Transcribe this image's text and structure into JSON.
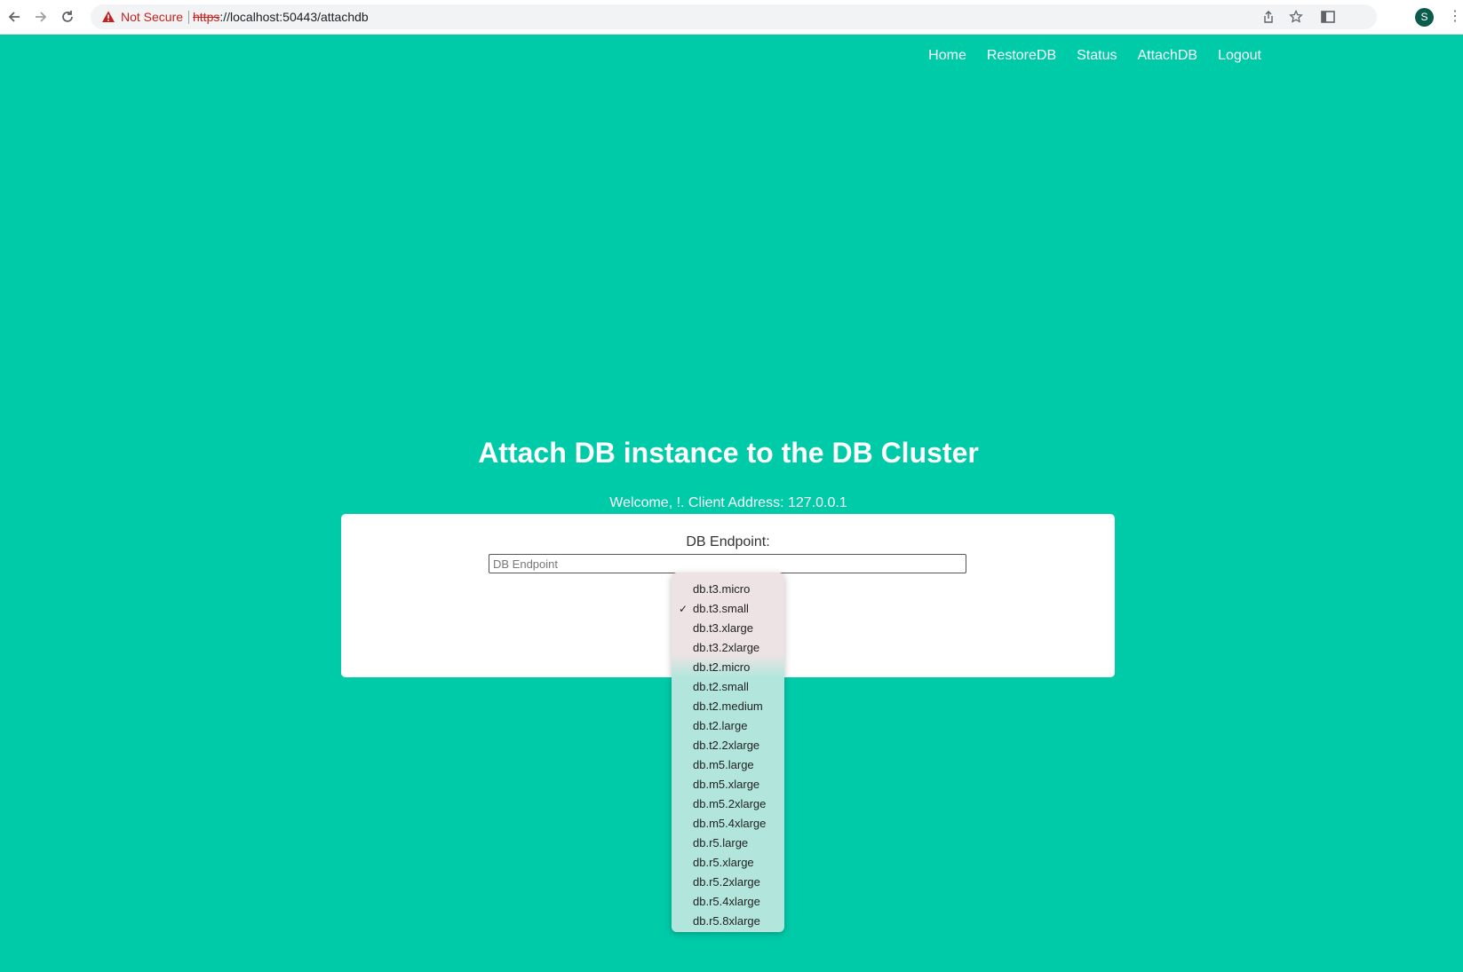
{
  "browser": {
    "security_label": "Not Secure",
    "url_scheme": "https",
    "url_rest": "://localhost:50443/attachdb",
    "profile_initial": "S"
  },
  "nav": {
    "items": [
      "Home",
      "RestoreDB",
      "Status",
      "AttachDB",
      "Logout"
    ]
  },
  "page": {
    "title": "Attach DB instance to the DB Cluster",
    "welcome": "Welcome, !. Client Address: 127.0.0.1"
  },
  "form": {
    "endpoint_label": "DB Endpoint:",
    "endpoint_placeholder": "DB Endpoint",
    "endpoint_value": ""
  },
  "instance_class_dropdown": {
    "selected": "db.t3.small",
    "options": [
      "db.t3.micro",
      "db.t3.small",
      "db.t3.xlarge",
      "db.t3.2xlarge",
      "db.t2.micro",
      "db.t2.small",
      "db.t2.medium",
      "db.t2.large",
      "db.t2.2xlarge",
      "db.m5.large",
      "db.m5.xlarge",
      "db.m5.2xlarge",
      "db.m5.4xlarge",
      "db.r5.large",
      "db.r5.xlarge",
      "db.r5.2xlarge",
      "db.r5.4xlarge",
      "db.r5.8xlarge"
    ]
  },
  "colors": {
    "page_background": "#00cba9",
    "warning_red": "#c5221f"
  }
}
